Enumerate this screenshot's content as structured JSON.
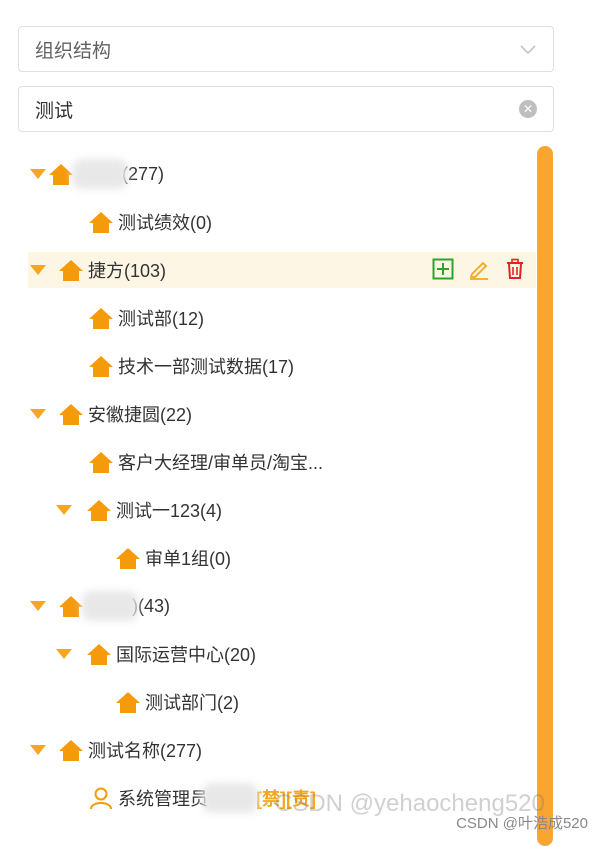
{
  "select": {
    "value": "组织结构"
  },
  "search": {
    "value": "测试"
  },
  "tree": {
    "n1": {
      "suffix": "(277)"
    },
    "n2": {
      "label": "测试绩效(0)"
    },
    "n3": {
      "label": "捷方(103)"
    },
    "n4": {
      "label": "测试部(12)"
    },
    "n5": {
      "label": "技术一部测试数据(17)"
    },
    "n6": {
      "label": "安徽捷圆(22)"
    },
    "n7": {
      "label": "客户大经理/审单员/淘宝..."
    },
    "n8": {
      "label": "测试一123(4)"
    },
    "n9": {
      "label": "审单1组(0)"
    },
    "n10": {
      "suffix": ")(43)"
    },
    "n11": {
      "label": "国际运营中心(20)"
    },
    "n12": {
      "label": "测试部门(2)"
    },
    "n13": {
      "label": "测试名称(277)"
    },
    "n14": {
      "label": "系统管理员",
      "tag": "[禁][责]"
    }
  },
  "watermark": {
    "text": "CSDN @yehaocheng520",
    "text2": "CSDN @叶浩成520"
  },
  "colors": {
    "accent": "#f5a623",
    "add": "#2aa52a",
    "edit": "#f5a623",
    "delete": "#e02424"
  }
}
